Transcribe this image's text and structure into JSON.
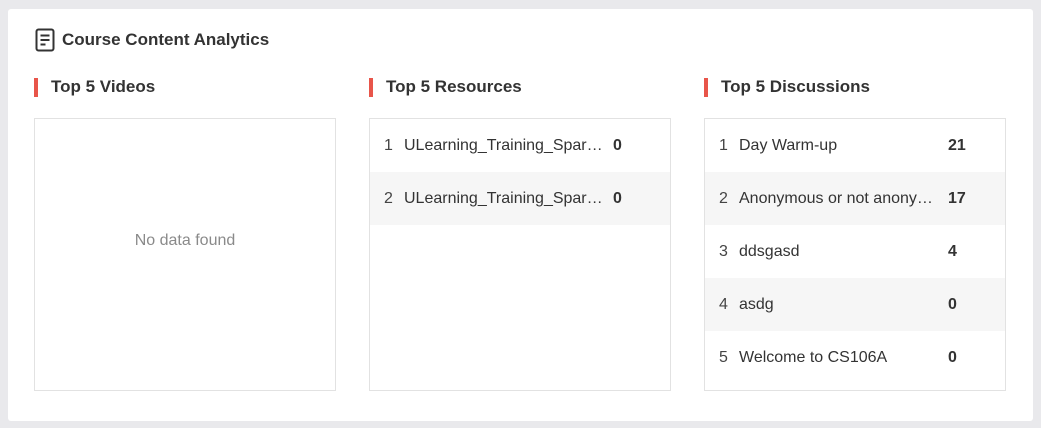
{
  "page": {
    "title": "Course Content Analytics",
    "icon": "document-icon",
    "accent_color": "#e8554a"
  },
  "videos": {
    "title": "Top 5 Videos",
    "empty_text": "No data found",
    "items": []
  },
  "resources": {
    "title": "Top 5 Resources",
    "items": [
      {
        "rank": "1",
        "name": "ULearning_Training_Sparrow",
        "count": "0"
      },
      {
        "rank": "2",
        "name": "ULearning_Training_Sparrow",
        "count": "0"
      }
    ]
  },
  "discussions": {
    "title": "Top 5 Discussions",
    "items": [
      {
        "rank": "1",
        "name": "Day Warm-up",
        "count": "21"
      },
      {
        "rank": "2",
        "name": "Anonymous or not anonymous",
        "count": "17"
      },
      {
        "rank": "3",
        "name": "ddsgasd",
        "count": "4"
      },
      {
        "rank": "4",
        "name": "asdg",
        "count": "0"
      },
      {
        "rank": "5",
        "name": "Welcome to CS106A",
        "count": "0"
      }
    ]
  }
}
